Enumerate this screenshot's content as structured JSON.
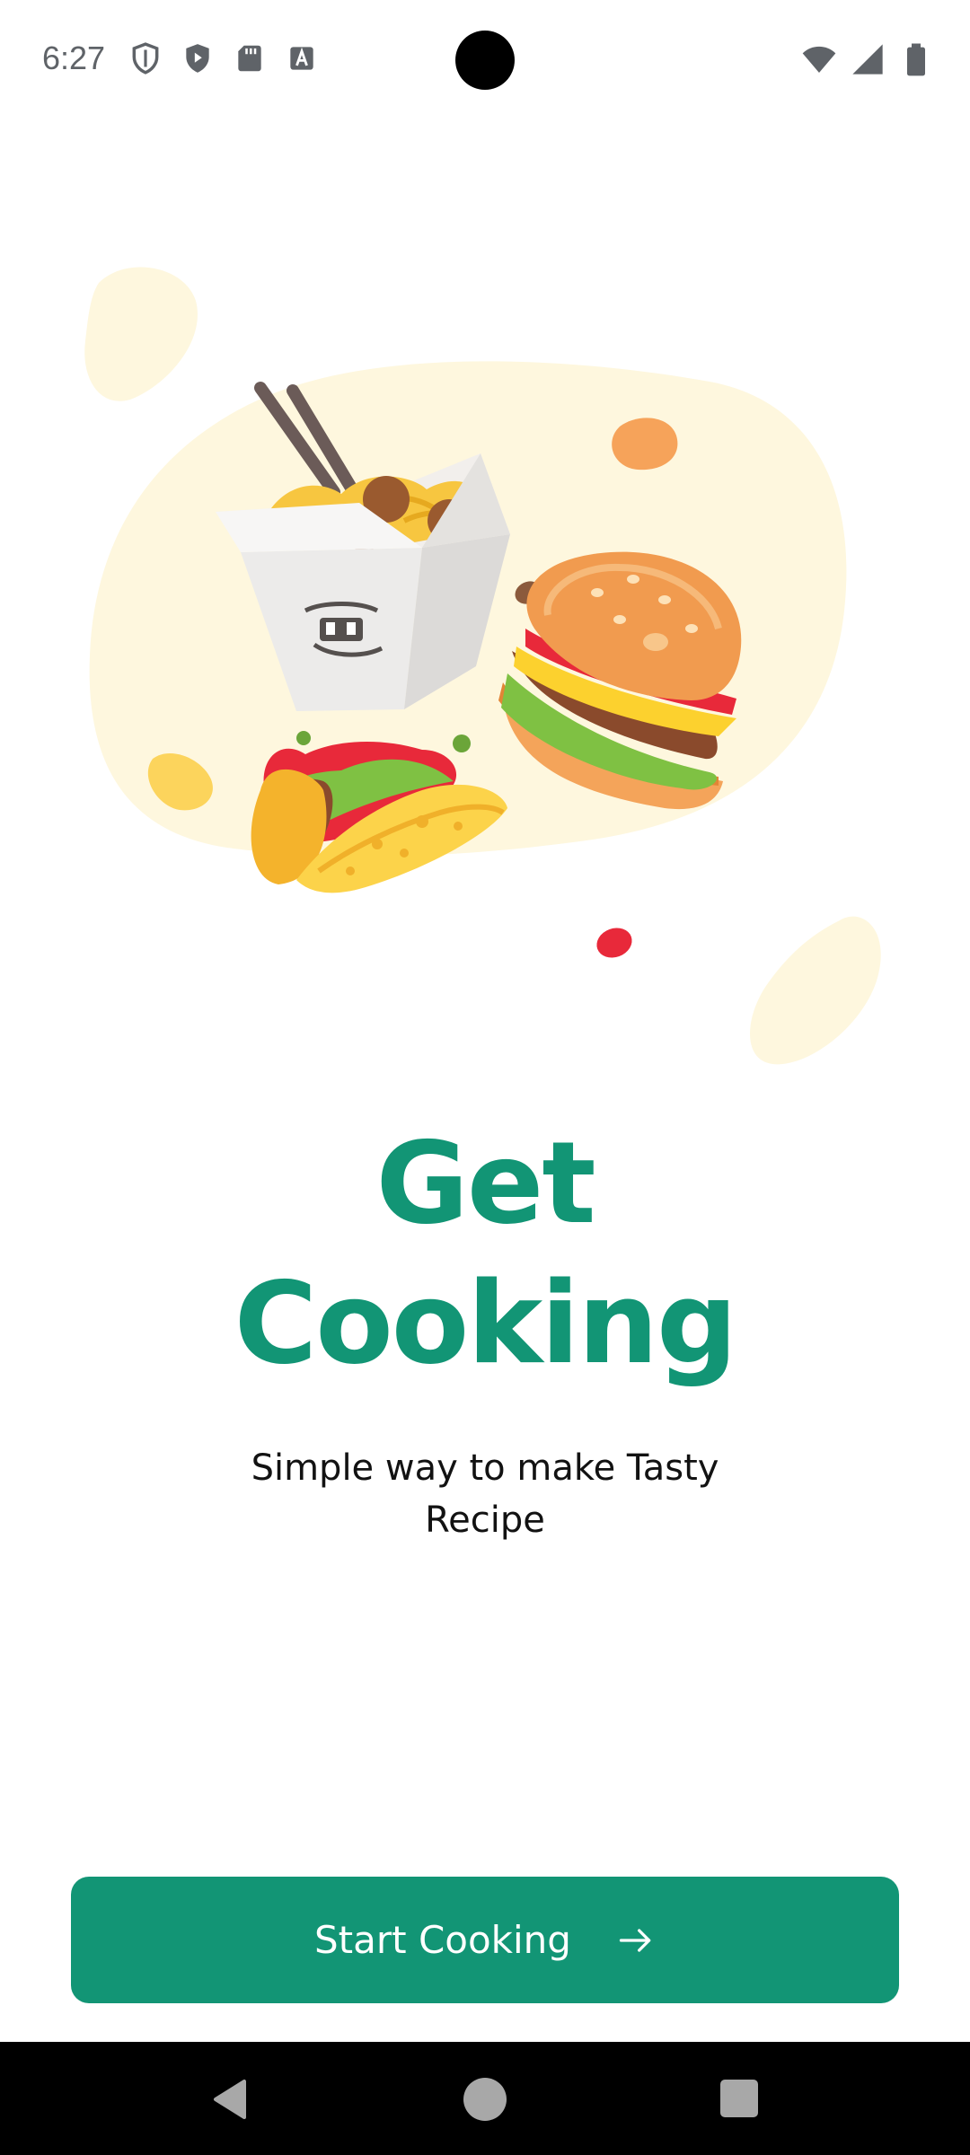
{
  "status_bar": {
    "time": "6:27",
    "left_icons": [
      "vpn-shield-icon",
      "play-protect-icon",
      "sd-card-icon",
      "font-a-icon"
    ],
    "right_icons": [
      "wifi-icon",
      "cellular-signal-icon",
      "battery-icon"
    ]
  },
  "onboarding": {
    "title_line1": "Get",
    "title_line2": "Cooking",
    "subtitle": "Simple way to make Tasty Recipe"
  },
  "cta": {
    "label": "Start Cooking",
    "icon": "arrow-right-icon"
  },
  "nav_bar": {
    "buttons": [
      "back-icon",
      "home-icon",
      "recents-icon"
    ]
  },
  "colors": {
    "accent": "#129575",
    "blob_cream": "#fef7de",
    "text_dark": "#121212",
    "nav_background": "#000000"
  }
}
